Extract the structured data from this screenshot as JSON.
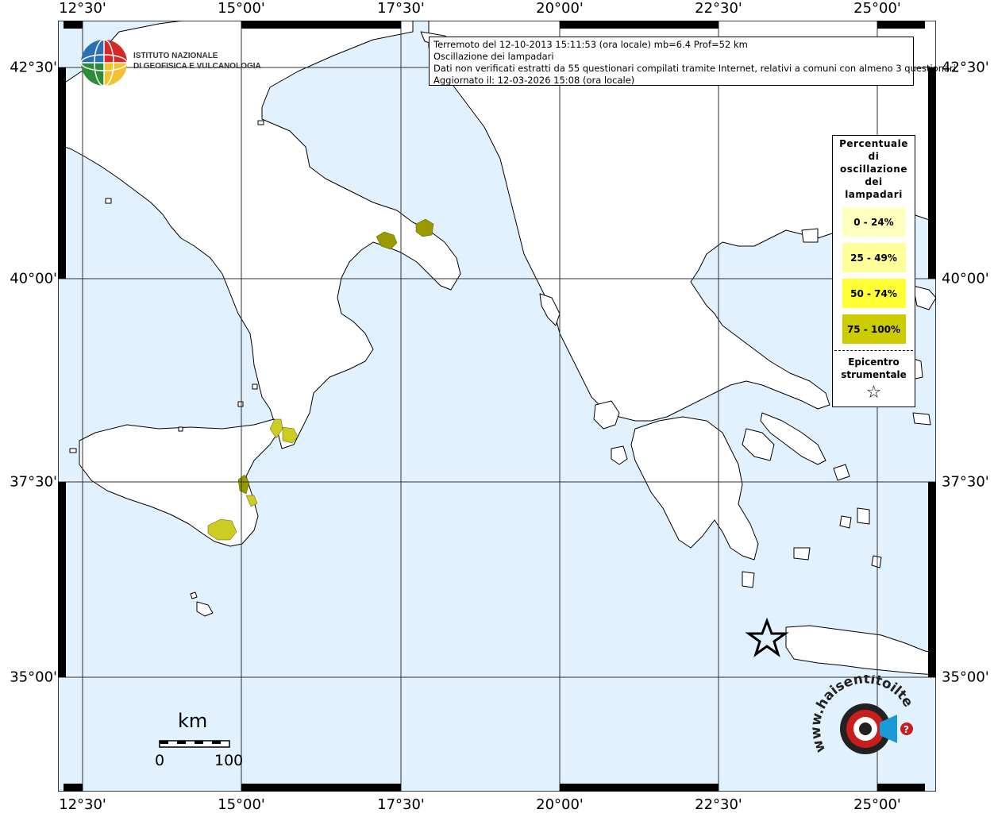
{
  "axes": {
    "top": [
      "12°30'",
      "15°00'",
      "17°30'",
      "20°00'",
      "22°30'",
      "25°00'"
    ],
    "bottom": [
      "12°30'",
      "15°00'",
      "17°30'",
      "20°00'",
      "22°30'",
      "25°00'"
    ],
    "left": [
      "42°30'",
      "40°00'",
      "37°30'",
      "35°00'"
    ],
    "right": [
      "42°30'",
      "40°00'",
      "37°30'",
      "35°00'"
    ]
  },
  "info": {
    "line1": "Terremoto del 12-10-2013 15:11:53 (ora locale) mb=6.4 Prof=52 km",
    "line2": "Oscillazione dei lampadari",
    "line3": "Dati non verificati estratti da 55 questionari compilati tramite Internet, relativi a comuni con almeno 3 questionari.",
    "line4": "Aggiornato il: 12-03-2026 15:08 (ora locale)"
  },
  "logo": {
    "line1": "ISTITUTO NAZIONALE",
    "line2": "DI GEOFISICA E VULCANOLOGIA"
  },
  "legend": {
    "title_lines": [
      "Percentuale",
      "di",
      "oscillazione",
      "dei",
      "lampadari"
    ],
    "items": [
      {
        "label": "0 - 24%",
        "color": "#ffffc0"
      },
      {
        "label": "25 - 49%",
        "color": "#ffff99"
      },
      {
        "label": "50 - 74%",
        "color": "#ffff33"
      },
      {
        "label": "75 - 100%",
        "color": "#cccc00"
      }
    ],
    "epicenter_lines": [
      "Epicentro",
      "strumentale"
    ],
    "star_symbol": "☆"
  },
  "scalebar": {
    "unit": "km",
    "min": "0",
    "max": "100"
  },
  "hsent": {
    "text": "www.haisentitoilterremoto.it"
  },
  "colors": {
    "sea": "#e1f1fd",
    "land": "#ffffff",
    "coast": "#000000",
    "level_75_100": "#999900",
    "level_50_74": "#cccc22"
  }
}
